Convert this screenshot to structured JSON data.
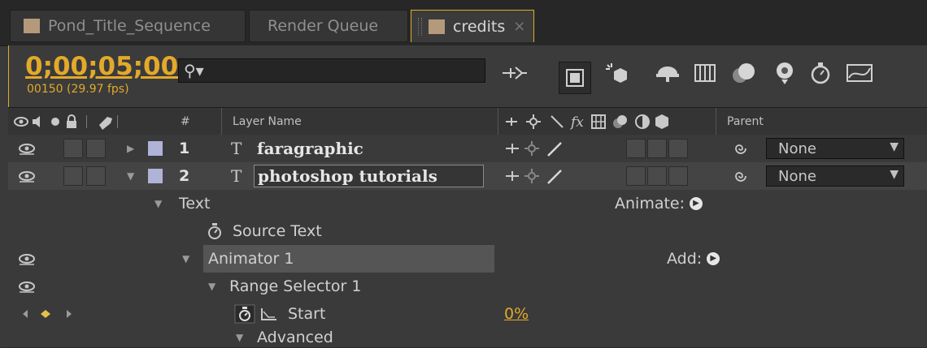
{
  "tabs": [
    {
      "label": "Pond_Title_Sequence",
      "active": false
    },
    {
      "label": "Render Queue",
      "active": false
    },
    {
      "label": "credits",
      "active": true
    }
  ],
  "tab_close": "×",
  "timecode": "0;00;05;00",
  "fps": "00150 (29.97 fps)",
  "search": {
    "placeholder": ""
  },
  "header": {
    "av_icons": "👁◀● 🔒",
    "label_icon": "◆",
    "hash": "#",
    "layer_name": "Layer Name",
    "switches": "-⊕- ✳ ╲ fx ▦ ◐ ◕ ◍",
    "parent": "Parent"
  },
  "layers": [
    {
      "num": "1",
      "type_glyph": "T",
      "name": "faragraphic",
      "parent": "None",
      "expanded": false
    },
    {
      "num": "2",
      "type_glyph": "T",
      "name": "photoshop tutorials",
      "parent": "None",
      "expanded": true
    }
  ],
  "properties": {
    "text_group": "Text",
    "animate_label": "Animate:",
    "source_text": "Source Text",
    "animator": "Animator 1",
    "add_label": "Add:",
    "range_selector": "Range Selector 1",
    "start_label": "Start",
    "start_value": "0%",
    "advanced": "Advanced"
  },
  "colors": {
    "accent": "#e3a92a",
    "label_layer": "#b0b2d8",
    "tab_swatch": "#b49a7a"
  }
}
